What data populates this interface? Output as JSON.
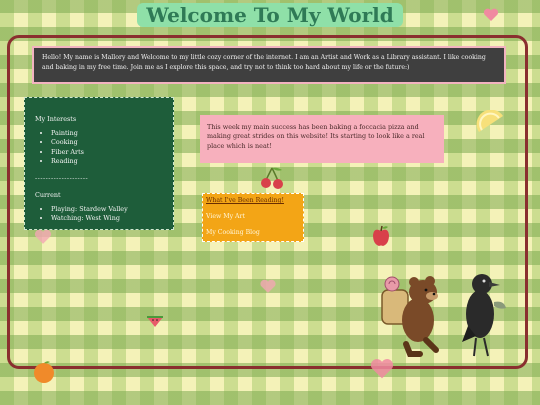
{
  "header": {
    "title": "Welcome To My World"
  },
  "intro": {
    "text": "Hello! My name is Mallory and Welcome to my little cozy corner of the internet. I am an Artist and Work as a Library assistant. I like cooking and baking in my free time. Join me as I explore this space, and try not to think too hard about my life or the future:)"
  },
  "interests": {
    "heading": "My Interests",
    "items": [
      "Painting",
      "Cooking",
      "Fiber Arts",
      "Reading"
    ],
    "divider": "--------------------",
    "current_heading": "Current",
    "current_items": [
      "Playing: Stardew Valley",
      "Watching: West Wing"
    ]
  },
  "update": {
    "text": "This week my main success has been baking a foccacia pizza and making great strides on this website! Its starting to look like a real place which is neat!"
  },
  "links": {
    "items": [
      "What I've Been Reading!",
      "View My Art",
      "My Cooking Blog"
    ]
  },
  "decor": {
    "icons": [
      "heart-icon",
      "cherry-icon",
      "apple-icon",
      "lemon-icon",
      "orange-icon",
      "watermelon-icon"
    ],
    "illustration": "bear-and-crow-illustration"
  }
}
